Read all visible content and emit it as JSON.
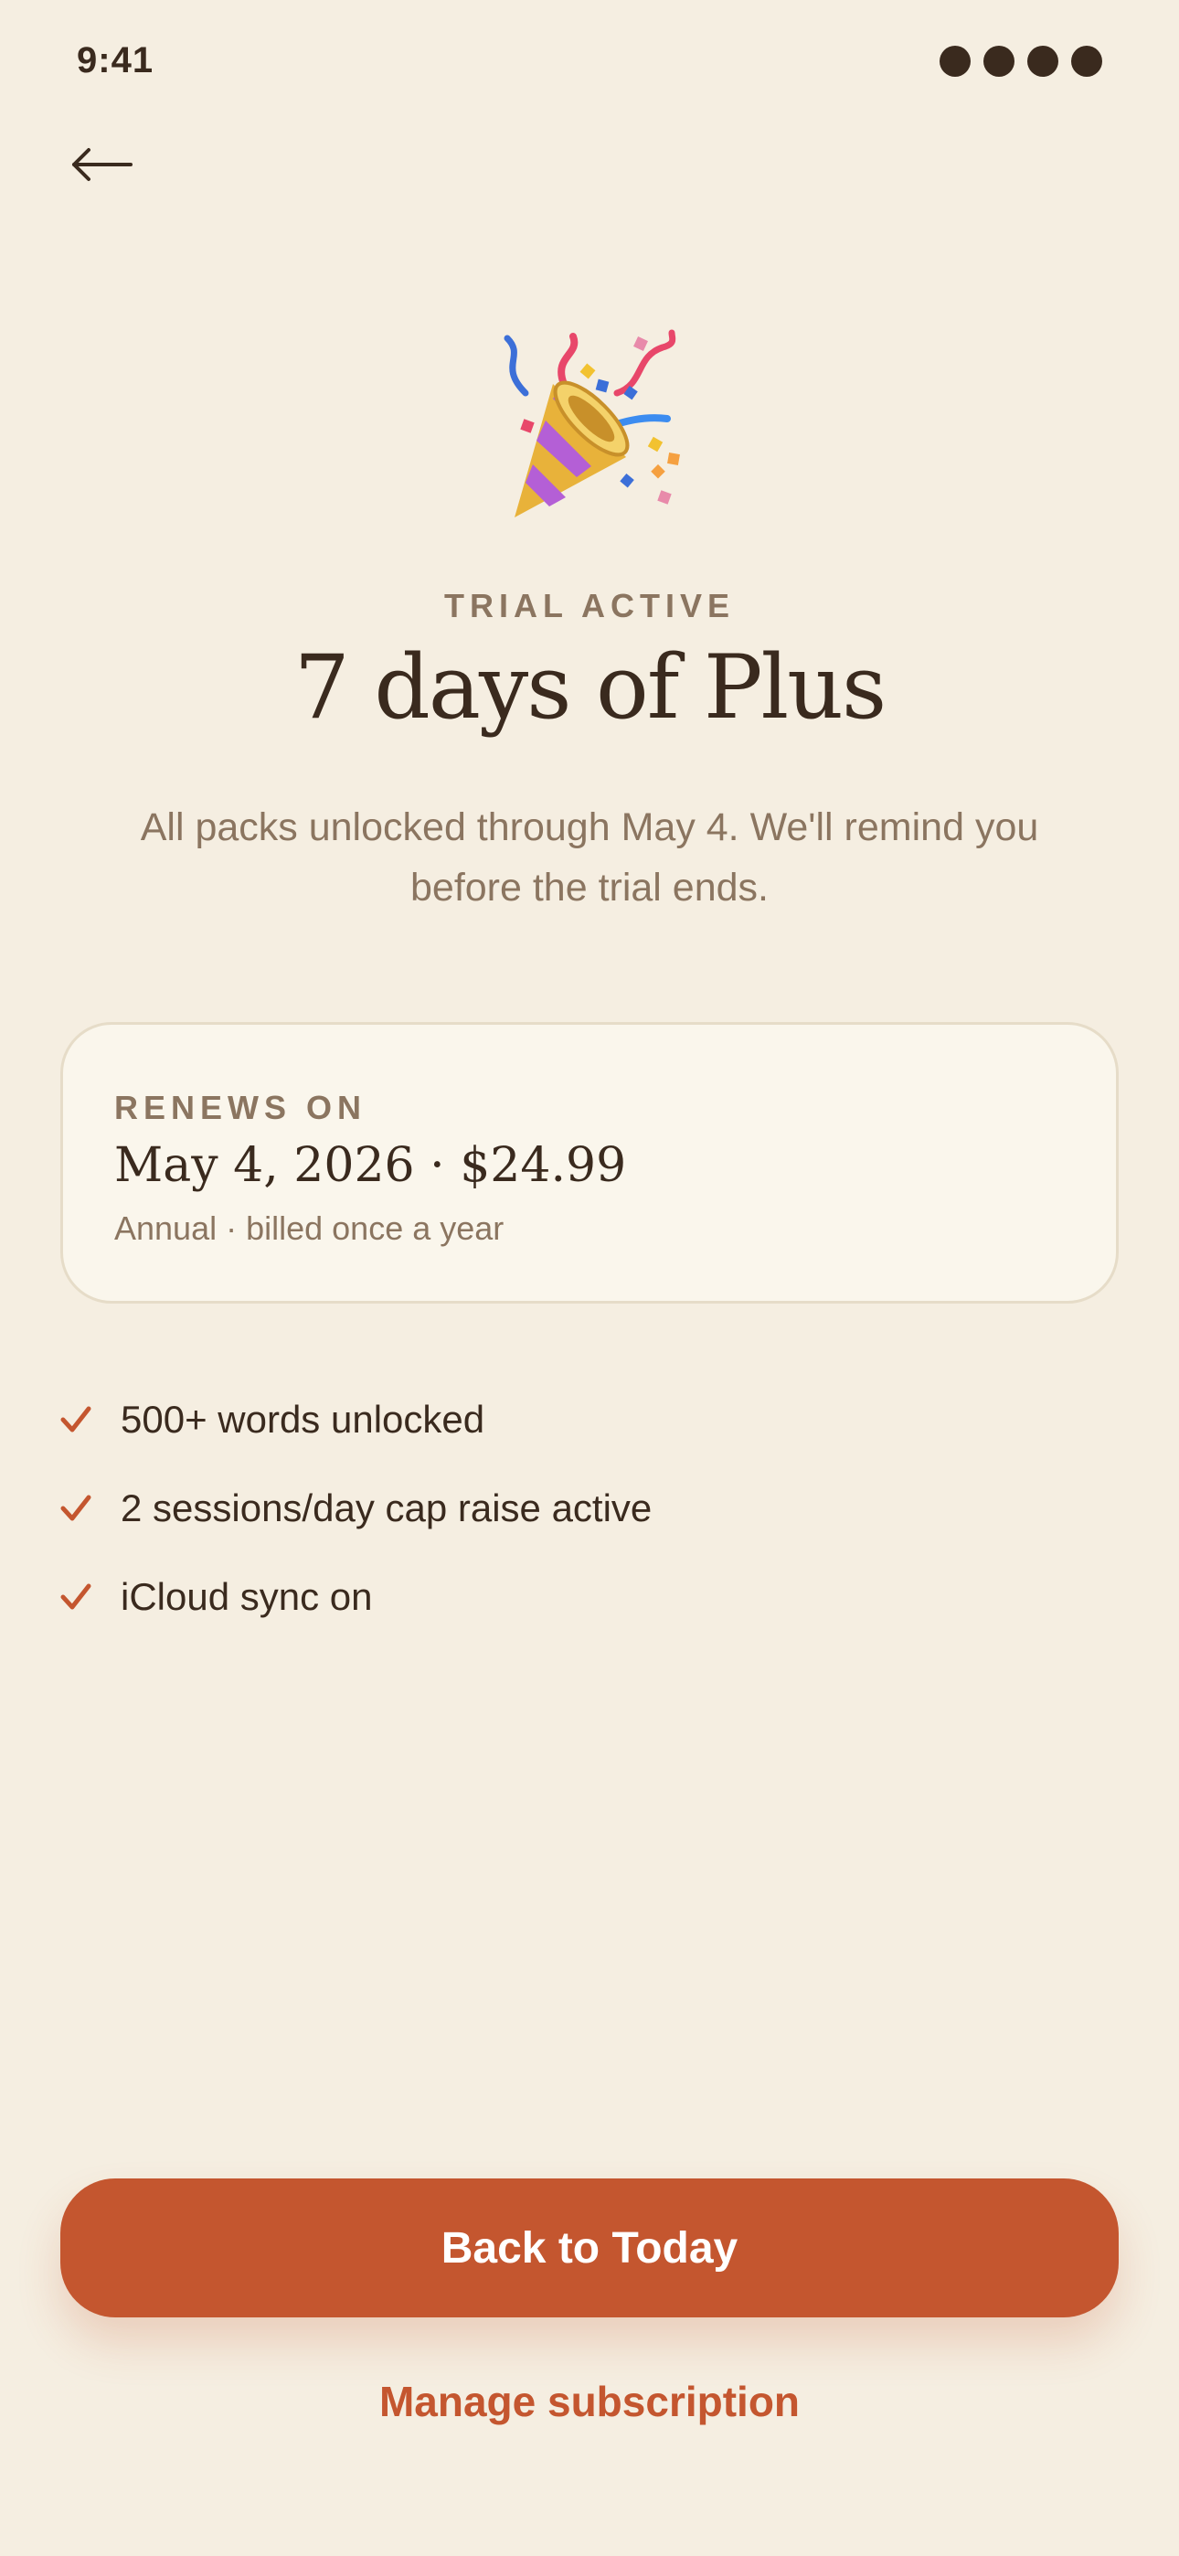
{
  "status_bar": {
    "time": "9:41"
  },
  "navigation": {
    "back_icon": "arrow-left-icon"
  },
  "hero": {
    "icon": "party-popper-icon",
    "eyebrow": "TRIAL ACTIVE",
    "title": "7 days of Plus",
    "subtitle": "All packs unlocked through May 4. We'll remind you before the trial ends."
  },
  "renewal_card": {
    "label": "RENEWS ON",
    "date_price": "May 4, 2026 · $24.99",
    "billing": "Annual · billed once a year"
  },
  "features": [
    {
      "icon": "checkmark-icon",
      "label": "500+ words unlocked"
    },
    {
      "icon": "checkmark-icon",
      "label": "2 sessions/day cap raise active"
    },
    {
      "icon": "checkmark-icon",
      "label": "iCloud sync on"
    }
  ],
  "actions": {
    "primary_label": "Back to Today",
    "secondary_label": "Manage subscription"
  },
  "colors": {
    "background": "#F5EEE1",
    "accent": "#C4562F",
    "text_primary": "#3A2A1E",
    "text_secondary": "#8B7560",
    "card_background": "#FAF6EC",
    "card_border": "#E6DCC8"
  }
}
